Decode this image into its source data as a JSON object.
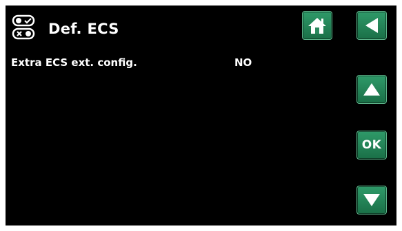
{
  "header": {
    "title": "Def. ECS",
    "icon": "settings-toggle-icon"
  },
  "setting": {
    "label": "Extra ECS ext. config.",
    "value": "NO"
  },
  "nav": {
    "home_icon": "home-icon",
    "back_icon": "back-arrow-icon",
    "up_icon": "up-arrow-icon",
    "ok_label": "OK",
    "down_icon": "down-arrow-icon"
  },
  "colors": {
    "background": "#000000",
    "button_green": "#2f9a69",
    "text": "#ffffff"
  }
}
